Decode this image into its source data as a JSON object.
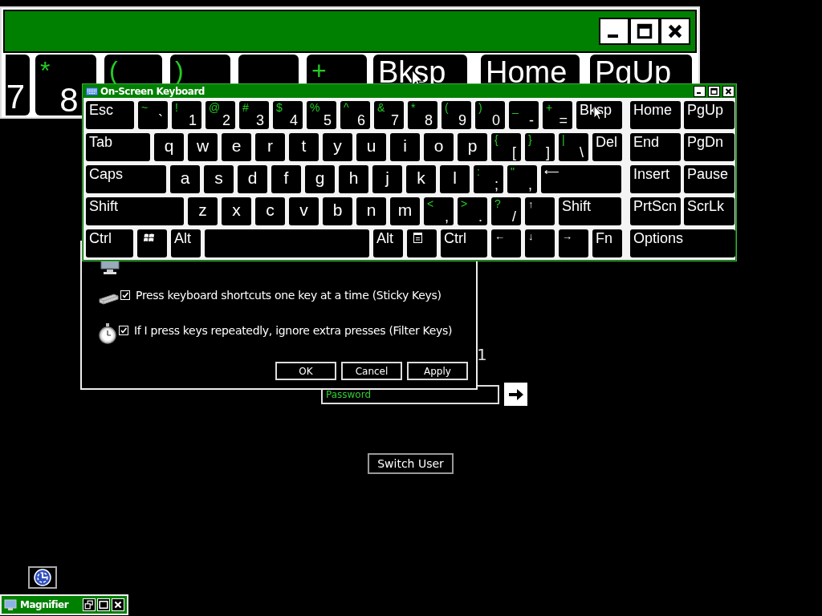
{
  "magnifier_view": {
    "keys": [
      {
        "kind": "key",
        "label": "7"
      },
      {
        "kind": "char",
        "shift": "*",
        "label": "8"
      },
      {
        "kind": "char",
        "shift": "("
      },
      {
        "kind": "char",
        "shift": ")"
      },
      {
        "kind": "char"
      },
      {
        "kind": "char",
        "shift": "+"
      },
      {
        "kind": "key",
        "label": "Bksp"
      },
      {
        "kind": "key",
        "label": "Home"
      },
      {
        "kind": "key",
        "label": "PgUp"
      }
    ]
  },
  "on_screen_keyboard": {
    "title": "On-Screen Keyboard",
    "rows": [
      {
        "keys": [
          {
            "kind": "key",
            "label": "Esc"
          },
          {
            "kind": "char",
            "shift": "~",
            "label": "`"
          },
          {
            "kind": "char",
            "shift": "!",
            "label": "1"
          },
          {
            "kind": "char",
            "shift": "@",
            "label": "2"
          },
          {
            "kind": "char",
            "shift": "#",
            "label": "3"
          },
          {
            "kind": "char",
            "shift": "$",
            "label": "4"
          },
          {
            "kind": "char",
            "shift": "%",
            "label": "5"
          },
          {
            "kind": "char",
            "shift": "^",
            "label": "6"
          },
          {
            "kind": "char",
            "shift": "&",
            "label": "7"
          },
          {
            "kind": "char",
            "shift": "*",
            "label": "8"
          },
          {
            "kind": "char",
            "shift": "(",
            "label": "9"
          },
          {
            "kind": "char",
            "shift": ")",
            "label": "0"
          },
          {
            "kind": "char",
            "shift": "_",
            "label": "-"
          },
          {
            "kind": "char",
            "shift": "+",
            "label": "="
          },
          {
            "kind": "key",
            "label": "Bksp"
          }
        ],
        "side_keys": [
          {
            "kind": "key",
            "label": "Home"
          },
          {
            "kind": "key",
            "label": "PgUp"
          }
        ]
      },
      {
        "keys": [
          {
            "kind": "key",
            "label": "Tab"
          },
          {
            "kind": "letter",
            "label": "q"
          },
          {
            "kind": "letter",
            "label": "w"
          },
          {
            "kind": "letter",
            "label": "e"
          },
          {
            "kind": "letter",
            "label": "r"
          },
          {
            "kind": "letter",
            "label": "t"
          },
          {
            "kind": "letter",
            "label": "y"
          },
          {
            "kind": "letter",
            "label": "u"
          },
          {
            "kind": "letter",
            "label": "i"
          },
          {
            "kind": "letter",
            "label": "o"
          },
          {
            "kind": "letter",
            "label": "p"
          },
          {
            "kind": "char",
            "shift": "{",
            "label": "["
          },
          {
            "kind": "char",
            "shift": "}",
            "label": "]"
          },
          {
            "kind": "char",
            "shift": "|",
            "label": "\\"
          },
          {
            "kind": "key",
            "label": "Del"
          }
        ],
        "side_keys": [
          {
            "kind": "key",
            "label": "End"
          },
          {
            "kind": "key",
            "label": "PgDn"
          }
        ]
      },
      {
        "keys": [
          {
            "kind": "key",
            "label": "Caps"
          },
          {
            "kind": "letter",
            "label": "a"
          },
          {
            "kind": "letter",
            "label": "s"
          },
          {
            "kind": "letter",
            "label": "d"
          },
          {
            "kind": "letter",
            "label": "f"
          },
          {
            "kind": "letter",
            "label": "g"
          },
          {
            "kind": "letter",
            "label": "h"
          },
          {
            "kind": "letter",
            "label": "j"
          },
          {
            "kind": "letter",
            "label": "k"
          },
          {
            "kind": "letter",
            "label": "l"
          },
          {
            "kind": "char",
            "shift": ":",
            "label": ";"
          },
          {
            "kind": "char",
            "shift": "\"",
            "label": ","
          },
          {
            "kind": "arrow",
            "label": "⟵"
          }
        ],
        "side_keys": [
          {
            "kind": "key",
            "label": "Insert"
          },
          {
            "kind": "key",
            "label": "Pause"
          }
        ]
      },
      {
        "keys": [
          {
            "kind": "key",
            "label": "Shift"
          },
          {
            "kind": "letter",
            "label": "z"
          },
          {
            "kind": "letter",
            "label": "x"
          },
          {
            "kind": "letter",
            "label": "c"
          },
          {
            "kind": "letter",
            "label": "v"
          },
          {
            "kind": "letter",
            "label": "b"
          },
          {
            "kind": "letter",
            "label": "n"
          },
          {
            "kind": "letter",
            "label": "m"
          },
          {
            "kind": "char",
            "shift": "<",
            "label": ","
          },
          {
            "kind": "char",
            "shift": ">",
            "label": "."
          },
          {
            "kind": "char",
            "shift": "?",
            "label": "/"
          },
          {
            "kind": "arrow",
            "label": "↑"
          },
          {
            "kind": "key",
            "label": "Shift"
          }
        ],
        "side_keys": [
          {
            "kind": "key",
            "label": "PrtScn"
          },
          {
            "kind": "key",
            "label": "ScrLk"
          }
        ]
      },
      {
        "keys": [
          {
            "kind": "key",
            "label": "Ctrl"
          },
          {
            "kind": "win"
          },
          {
            "kind": "key",
            "label": "Alt"
          },
          {
            "kind": "space"
          },
          {
            "kind": "key",
            "label": "Alt"
          },
          {
            "kind": "menu"
          },
          {
            "kind": "key",
            "label": "Ctrl"
          },
          {
            "kind": "arrow",
            "label": "←"
          },
          {
            "kind": "arrow",
            "label": "↓"
          },
          {
            "kind": "arrow",
            "label": "→"
          },
          {
            "kind": "key",
            "label": "Fn"
          }
        ],
        "side_keys": [
          {
            "kind": "key",
            "label": "Options"
          }
        ]
      }
    ]
  },
  "dialog": {
    "options": [
      {
        "label": "Press keyboard shortcuts one key at a time (Sticky Keys)",
        "checked": true
      },
      {
        "label": "If I press keys repeatedly, ignore extra presses (Filter Keys)",
        "checked": true
      }
    ],
    "buttons": [
      "OK",
      "Cancel",
      "Apply"
    ]
  },
  "login": {
    "user_name": "1",
    "password": {
      "placeholder": "Password"
    },
    "switch_user": "Switch User"
  },
  "magnifier_toolbar": {
    "title": "Magnifier"
  }
}
